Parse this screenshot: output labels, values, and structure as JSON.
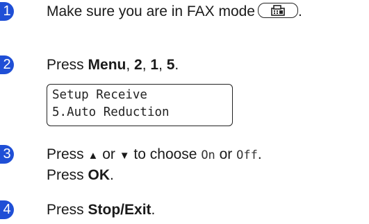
{
  "steps": [
    {
      "number": "1",
      "text": "Make sure you are in FAX mode",
      "trailing": "."
    },
    {
      "number": "2",
      "prefix": "Press ",
      "keys": [
        "Menu",
        "2",
        "1",
        "5"
      ],
      "sep": ", ",
      "suffix": "."
    },
    {
      "number": "3",
      "line1_prefix": "Press ",
      "up_arrow": "▲",
      "or1": " or ",
      "down_arrow": "▼",
      "line1_mid": " to choose ",
      "opt_on": "On",
      "or2": " or ",
      "opt_off": "Off",
      "line1_end": ".",
      "line2_prefix": "Press ",
      "line2_key": "OK",
      "line2_end": "."
    },
    {
      "number": "4",
      "prefix": "Press ",
      "key": "Stop/Exit",
      "suffix": "."
    }
  ],
  "lcd": {
    "line1": "Setup Receive",
    "line2": "5.Auto Reduction"
  },
  "icons": {
    "fax_button": "fax-mode-button-icon"
  },
  "colors": {
    "badge": "#1f4fd6"
  }
}
